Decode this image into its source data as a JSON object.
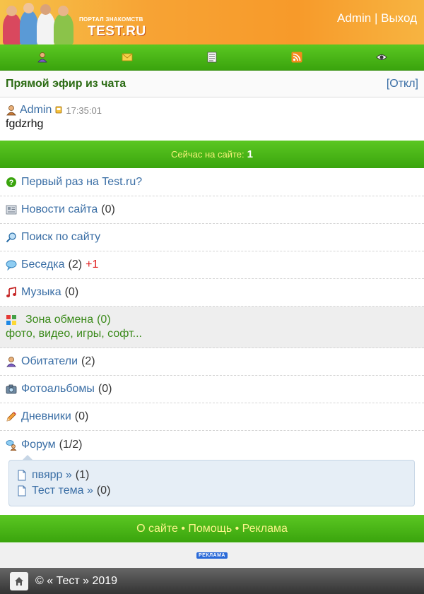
{
  "header": {
    "logo_top": "ПОРТАЛ ЗНАКОМСТВ",
    "logo_main": "TEST.RU",
    "user_link": "Admin",
    "separator": "|",
    "logout_link": "Выход"
  },
  "iconbar": {
    "items": [
      "profile-icon",
      "mail-icon",
      "notes-icon",
      "rss-icon",
      "eye-icon"
    ]
  },
  "chat": {
    "title": "Прямой эфир из чата",
    "toggle": "[Откл]",
    "author": "Admin",
    "time": "17:35:01",
    "message": "fgdzrhg"
  },
  "online": {
    "label": "Сейчас на сайте:",
    "count": "1"
  },
  "menu": {
    "first_time": "Первый раз на Test.ru?",
    "news": {
      "label": "Новости сайта",
      "count": "(0)"
    },
    "search": "Поиск по сайту",
    "chat": {
      "label": "Беседка",
      "count": "(2)",
      "new": "+1"
    },
    "music": {
      "label": "Музыка",
      "count": "(0)"
    },
    "exchange": {
      "label": "Зона обмена",
      "count": "(0)",
      "sub": "фото, видео, игры, софт..."
    },
    "residents": {
      "label": "Обитатели",
      "count": "(2)"
    },
    "albums": {
      "label": "Фотоальбомы",
      "count": "(0)"
    },
    "diaries": {
      "label": "Дневники",
      "count": "(0)"
    },
    "forum": {
      "label": "Форум",
      "count": "(1/2)"
    }
  },
  "forum_topics": [
    {
      "label": "пвярр »",
      "count": "(1)"
    },
    {
      "label": "Тест тема »",
      "count": "(0)"
    }
  ],
  "footer": {
    "links": "О сайте • Помощь • Реклама",
    "ad_badge": "РЕКЛАМА",
    "copyright": "© « Тест » 2019"
  },
  "colors": {
    "green_bar": "#3aa40d",
    "header_orange": "#f7a334",
    "link_blue": "#3a6ea5",
    "exchange_green": "#3b8a1b"
  }
}
